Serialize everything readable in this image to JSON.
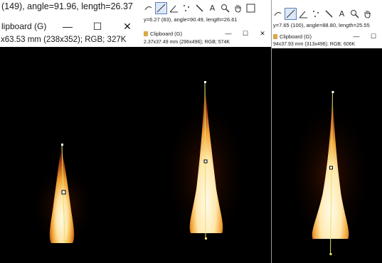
{
  "windows": [
    {
      "status": "(149), angle=91.96, length=26.37",
      "title": "lipboard (G)",
      "info": "x63.53 mm (238x352); RGB; 327K"
    },
    {
      "status": "y=6.27 (83), angle=90.49, length=26.61",
      "title": "Clipboard (G)",
      "info": "2.37x37.49 mm (296x496); RGB; 574K"
    },
    {
      "status": "y=7.65 (100), angle=88.80, length=25.55",
      "title": "Clipboard (G)",
      "info": "94x37.93 mm (313x496); RGB; 606K"
    }
  ],
  "controls": {
    "minimize": "—",
    "maximize": "☐",
    "close": "✕"
  },
  "tool_glyphs": {
    "text": "A",
    "magnifier": "🔍",
    "hand": "✋"
  }
}
